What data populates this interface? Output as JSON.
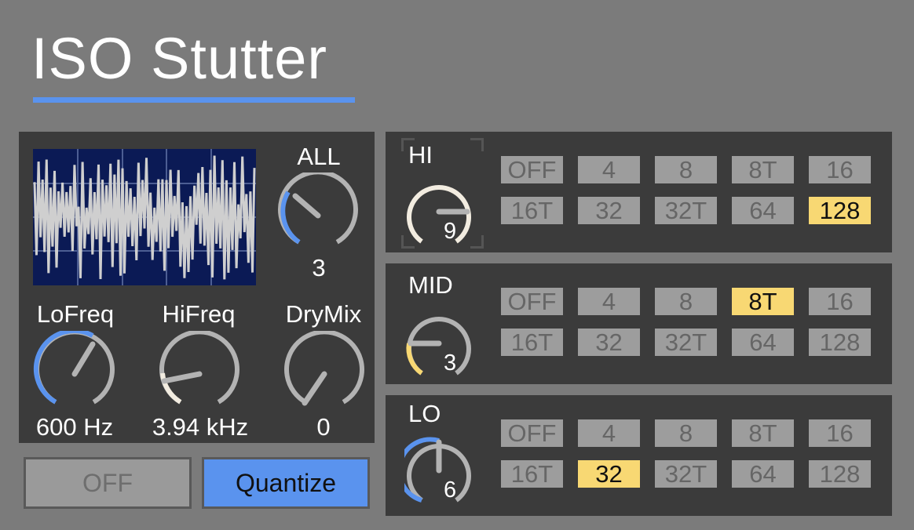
{
  "title": "ISO Stutter",
  "colors": {
    "background": "#7b7b7b",
    "panel": "#3b3b3b",
    "accent_blue": "#5a93ee",
    "accent_yellow": "#f8d873",
    "knob_track": "#b3b3b3",
    "scope_bg": "#0b1a55"
  },
  "left": {
    "all": {
      "label": "ALL",
      "value": "3"
    },
    "lofreq": {
      "label": "LoFreq",
      "value": "600 Hz"
    },
    "hifreq": {
      "label": "HiFreq",
      "value": "3.94 kHz"
    },
    "drymix": {
      "label": "DryMix",
      "value": "0"
    },
    "off_button": "OFF",
    "quantize_button": "Quantize"
  },
  "rates": [
    "OFF",
    "4",
    "8",
    "8T",
    "16",
    "16T",
    "32",
    "32T",
    "64",
    "128"
  ],
  "bands": [
    {
      "label": "HI",
      "value": "9",
      "selected": "128"
    },
    {
      "label": "MID",
      "value": "3",
      "selected": "8T"
    },
    {
      "label": "LO",
      "value": "6",
      "selected": "32"
    }
  ]
}
